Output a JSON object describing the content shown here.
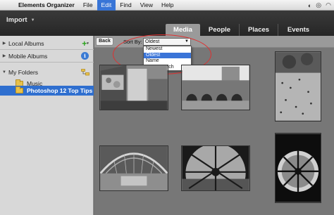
{
  "menubar": {
    "app_name": "Elements Organizer",
    "menus": [
      "File",
      "Edit",
      "Find",
      "View",
      "Help"
    ],
    "active_menu": "Edit"
  },
  "toolbar": {
    "import_label": "Import",
    "tabs": [
      "Media",
      "People",
      "Places",
      "Events"
    ],
    "active_tab": "Media"
  },
  "sidebar": {
    "local_albums": "Local Albums",
    "mobile_albums": "Mobile Albums",
    "my_folders": "My Folders",
    "folders": [
      "Music",
      "Photoshop 12 Top Tips"
    ],
    "selected_folder": "Photoshop 12 Top Tips"
  },
  "sortbar": {
    "back_label": "Back",
    "sort_label": "Sort By:",
    "selected": "Oldest",
    "options": [
      "Newest",
      "Oldest",
      "Name",
      "Import Batch"
    ],
    "highlighted": "Oldest"
  },
  "colors": {
    "selection_blue": "#2f6fcf",
    "annotation_red": "#e03030",
    "add_green": "#2aa31c"
  },
  "icons": {
    "apple": "apple-logo-icon",
    "add": "plus-icon",
    "info": "info-icon",
    "folder": "folder-icon",
    "disclosure": "disclosure-triangle-icon"
  },
  "photos": [
    "graffiti-wall",
    "courtyard-arches",
    "square-crowd",
    "station-hall-interior",
    "clock-window-view",
    "clock-face-silhouette"
  ]
}
